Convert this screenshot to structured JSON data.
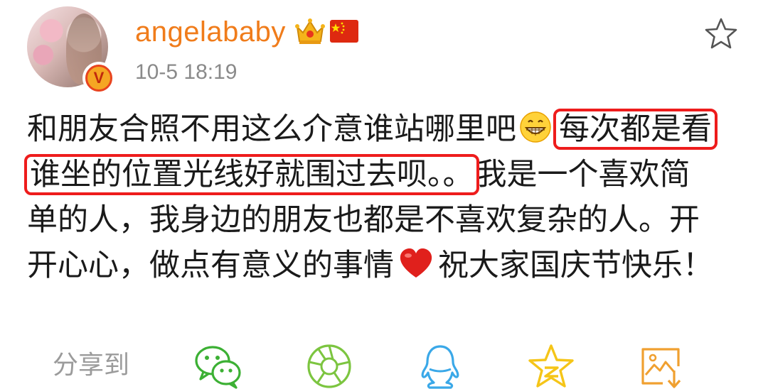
{
  "header": {
    "username": "angelababy",
    "timestamp": "10-5 18:19",
    "verified_badge": "V"
  },
  "post": {
    "line1_a": "和朋友合照不用这么介意谁站哪里吧",
    "line1_b": "每次都是看",
    "line2_a": "谁坐的位置光线好就围过去呗。。",
    "line2_b": "我是一个喜欢简",
    "line3": "单的人，我身边的朋友也都是不喜欢复杂的人。开",
    "line4_a": "开心心，做点有意义的事情",
    "line4_b": "祝大家国庆节快乐！"
  },
  "share": {
    "label": "分享到",
    "targets": [
      "wechat-icon",
      "moments-icon",
      "qq-icon",
      "qzone-icon",
      "save-image-icon"
    ]
  },
  "colors": {
    "username": "#f07c1b",
    "timestamp": "#8a8a8a",
    "highlight": "#ee1c1c",
    "wechat": "#3cb034",
    "qq": "#3aa8e8",
    "qzone": "#f5c518",
    "save": "#f0a030"
  },
  "icons": {
    "crown": "crown-icon",
    "flag": "china-flag-icon",
    "favorite": "star-outline-icon",
    "emoji1": "grin-emoji-icon",
    "emoji2": "heart-emoji-icon"
  }
}
